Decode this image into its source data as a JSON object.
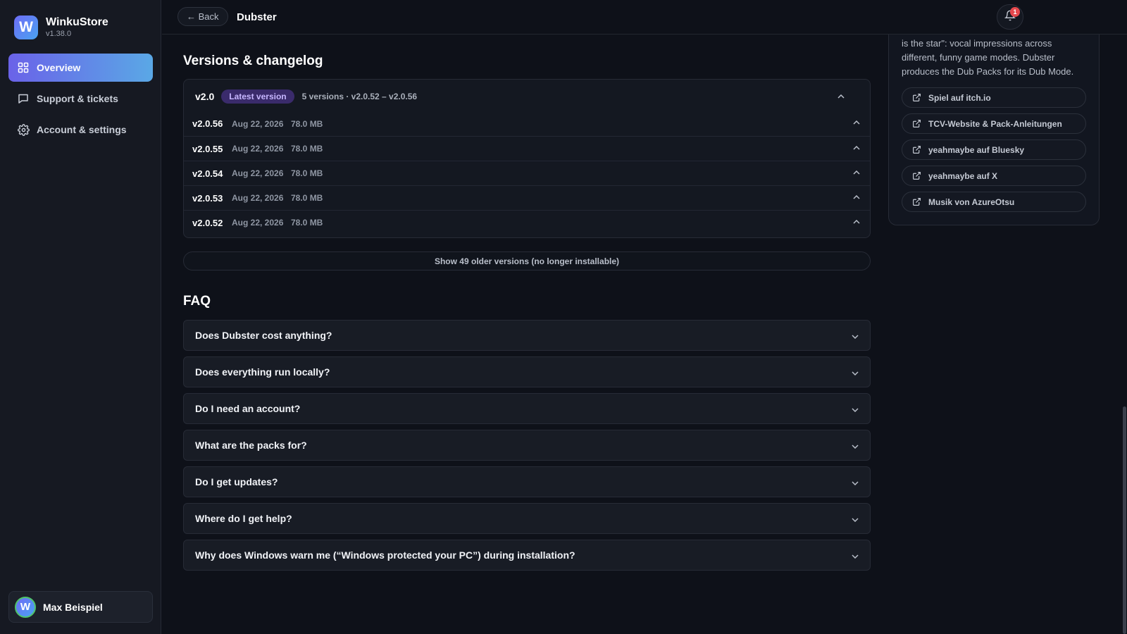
{
  "app": {
    "name": "WinkuStore",
    "version": "v1.38.0",
    "logo_letter": "W"
  },
  "sidebar": {
    "items": [
      {
        "label": "Overview",
        "icon": "grid-icon",
        "active": true
      },
      {
        "label": "Support & tickets",
        "icon": "chat-icon",
        "active": false
      },
      {
        "label": "Account & settings",
        "icon": "gear-icon",
        "active": false
      }
    ],
    "user": {
      "name": "Max Beispiel",
      "avatar_letter": "W"
    }
  },
  "header": {
    "back_label": "← Back",
    "title": "Dubster",
    "notifications": {
      "count": "1",
      "icon": "bell-icon"
    }
  },
  "versions": {
    "section_title": "Versions & changelog",
    "major": "v2.0",
    "latest_badge": "Latest version",
    "summary": "5 versions · v2.0.52 – v2.0.56",
    "rows": [
      {
        "name": "v2.0.56",
        "date": "Aug 22, 2026",
        "size": "78.0 MB"
      },
      {
        "name": "v2.0.55",
        "date": "Aug 22, 2026",
        "size": "78.0 MB"
      },
      {
        "name": "v2.0.54",
        "date": "Aug 22, 2026",
        "size": "78.0 MB"
      },
      {
        "name": "v2.0.53",
        "date": "Aug 22, 2026",
        "size": "78.0 MB"
      },
      {
        "name": "v2.0.52",
        "date": "Aug 22, 2026",
        "size": "78.0 MB"
      }
    ],
    "older_button": "Show 49 older versions (no longer installable)"
  },
  "faq": {
    "section_title": "FAQ",
    "items": [
      "Does Dubster cost anything?",
      "Does everything run locally?",
      "Do I need an account?",
      "What are the packs for?",
      "Do I get updates?",
      "Where do I get help?",
      "Why does Windows warn me (“Windows protected your PC”) during installation?"
    ]
  },
  "about": {
    "description": "is the star\": vocal impressions across different, funny game modes. Dubster produces the Dub Packs for its Dub Mode.",
    "links": [
      "Spiel auf itch.io",
      "TCV-Website & Pack-Anleitungen",
      "yeahmaybe auf Bluesky",
      "yeahmaybe auf X",
      "Musik von AzureOtsu"
    ]
  },
  "colors": {
    "background": "#0e1119",
    "sidebar": "#161922",
    "accent_start": "#6a62e8",
    "accent_end": "#5aa8e6",
    "badge": "#3a2b6b",
    "notification": "#e5484d"
  }
}
